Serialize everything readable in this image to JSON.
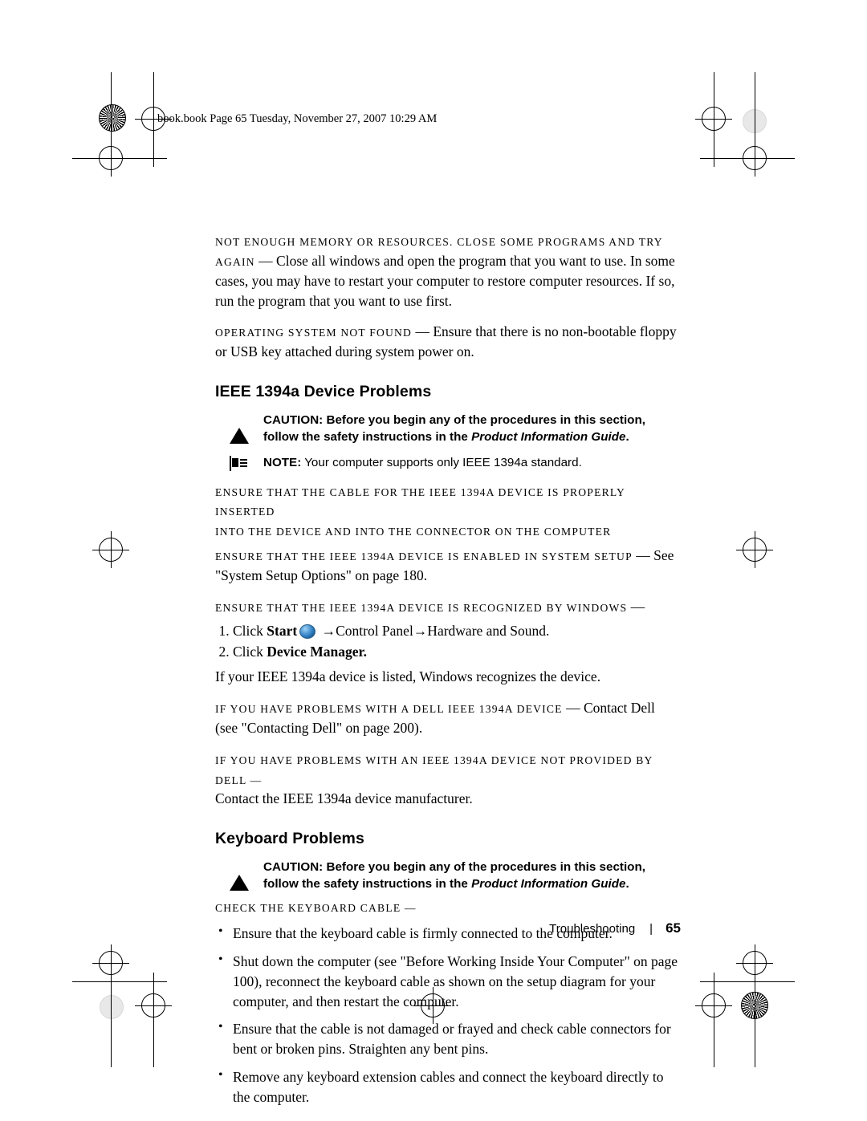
{
  "header": {
    "file_line": "book.book  Page 65  Tuesday, November 27, 2007  10:29 AM"
  },
  "body": {
    "para_memory_lead": "NOT ENOUGH MEMORY OR RESOURCES. CLOSE SOME PROGRAMS AND TRY",
    "para_memory_lead2": "AGAIN",
    "para_memory_text": " — Close all windows and open the program that you want to use. In some cases, you may have to restart your computer to restore computer resources. If so, run the program that you want to use first.",
    "para_os_lead": "OPERATING SYSTEM NOT FOUND",
    "para_os_text": " — Ensure that there is no non-bootable floppy or USB key attached during system power on."
  },
  "section_ieee": {
    "heading": "IEEE 1394a Device Problems",
    "caution_label": "CAUTION:",
    "caution_text": " Before you begin any of the procedures in this section, follow the safety instructions in the ",
    "caution_italic": "Product Information Guide",
    "caution_end": ".",
    "note_label": "NOTE:",
    "note_text": " Your computer supports only IEEE 1394a standard.",
    "item1_line1": "ENSURE THAT THE CABLE FOR THE IEEE 1394A DEVICE IS PROPERLY INSERTED",
    "item1_line2": "INTO THE DEVICE AND INTO THE CONNECTOR ON THE COMPUTER",
    "item2_lead": "ENSURE THAT THE IEEE 1394A DEVICE IS ENABLED IN SYSTEM SETUP",
    "item2_text": " —  See \"System Setup Options\" on page 180.",
    "item3_lead": "ENSURE THAT THE IEEE 1394A DEVICE IS RECOGNIZED BY WINDOWS",
    "item3_dash": " —",
    "step1_pre": "Click ",
    "step1_start": "Start",
    "step1_post": " →Control Panel→Hardware and Sound.",
    "step2_pre": "Click ",
    "step2_bold": "Device Manager.",
    "after_steps": "If your IEEE 1394a device is listed, Windows recognizes the device.",
    "item4_lead": "IF YOU HAVE PROBLEMS WITH A DELL IEEE 1394A DEVICE",
    "item4_text": " — Contact Dell (see \"Contacting Dell\" on page 200).",
    "item5_lead": "IF YOU HAVE PROBLEMS WITH AN IEEE 1394A DEVICE NOT PROVIDED BY DELL —",
    "item5_text": "Contact the IEEE 1394a device manufacturer."
  },
  "section_keyboard": {
    "heading": "Keyboard Problems",
    "caution_label": "CAUTION:",
    "caution_text": " Before you begin any of the procedures in this section, follow the safety instructions in the ",
    "caution_italic": "Product Information Guide",
    "caution_end": ".",
    "check_lead": "CHECK THE KEYBOARD CABLE —",
    "bullets": [
      "Ensure that the keyboard cable is firmly connected to the computer.",
      "Shut down the computer (see \"Before Working Inside Your Computer\" on page 100), reconnect the keyboard cable as shown on the setup diagram for your computer, and then restart the computer.",
      "Ensure that the cable is not damaged or frayed and check cable connectors for bent or broken pins. Straighten any bent pins.",
      "Remove any keyboard extension cables and connect the keyboard directly to the computer."
    ]
  },
  "footer": {
    "chapter": "Troubleshooting",
    "separator": "|",
    "page_number": "65"
  }
}
